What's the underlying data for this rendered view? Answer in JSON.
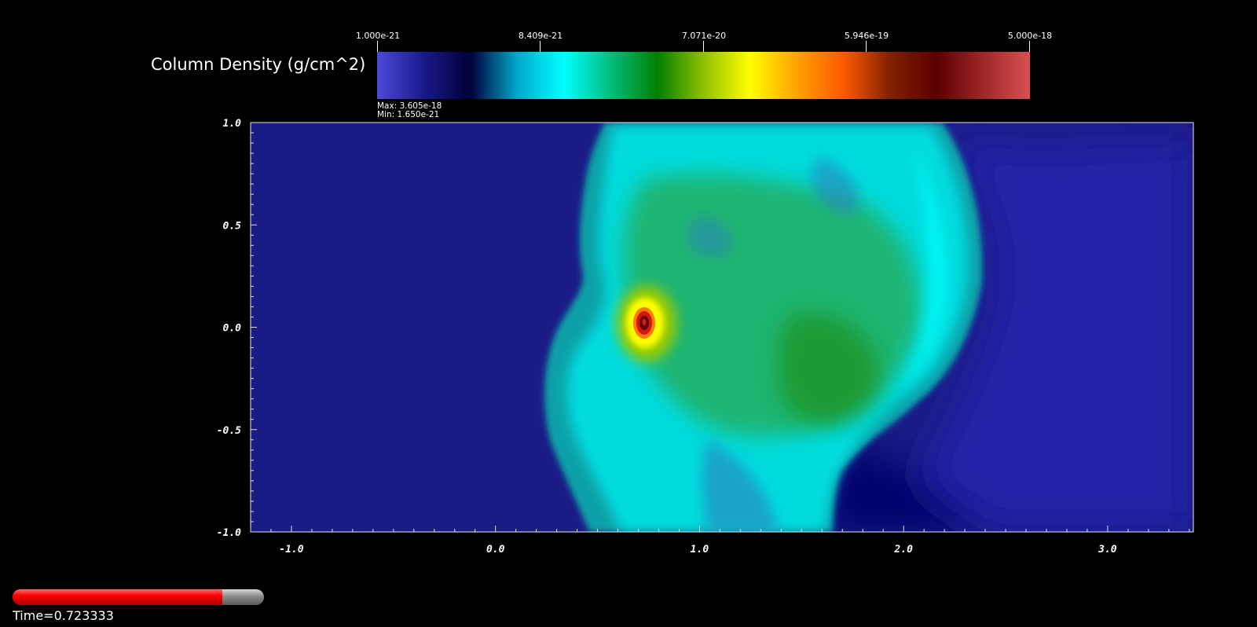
{
  "colorbar": {
    "title": "Column Density (g/cm^2)",
    "tick_labels": [
      "1.000e-21",
      "8.409e-21",
      "7.071e-20",
      "5.946e-19",
      "5.000e-18"
    ],
    "max_label": "Max:  3.605e-18",
    "min_label": "Min:  1.650e-21",
    "colors": [
      "#4b4ad8",
      "#1a1a8c",
      "#00003a",
      "#00a7c9",
      "#00ffff",
      "#00bf80",
      "#008000",
      "#8fbf00",
      "#ffff00",
      "#ffa000",
      "#ff5a00",
      "#802000",
      "#5a0000",
      "#a02828",
      "#d85050"
    ]
  },
  "chart_data": {
    "type": "heatmap",
    "title": "",
    "xlabel": "",
    "ylabel": "",
    "xlim": [
      -1.2,
      3.42
    ],
    "ylim": [
      -1.0,
      1.0
    ],
    "x_ticks": [
      {
        "value": -1.0,
        "label": "-1.0"
      },
      {
        "value": 0.0,
        "label": "0.0"
      },
      {
        "value": 1.0,
        "label": "1.0"
      },
      {
        "value": 2.0,
        "label": "2.0"
      },
      {
        "value": 3.0,
        "label": "3.0"
      }
    ],
    "y_ticks": [
      {
        "value": 1.0,
        "label": "1.0"
      },
      {
        "value": 0.5,
        "label": "0.5"
      },
      {
        "value": 0.0,
        "label": "0.0"
      },
      {
        "value": -0.5,
        "label": "-0.5"
      },
      {
        "value": -1.0,
        "label": "-1.0"
      }
    ],
    "colorscale": "log",
    "color_range": [
      1e-21,
      5e-18
    ],
    "data_range": {
      "max": 3.605e-18,
      "min": 1.65e-21
    },
    "background_color": "#1b1b86",
    "cloud_color": "#14b49a",
    "core_color": "#d01818",
    "core_center": [
      0.73,
      0.02
    ],
    "grid": false
  },
  "time_slider": {
    "label": "Time=0.723333",
    "progress": 0.833
  }
}
